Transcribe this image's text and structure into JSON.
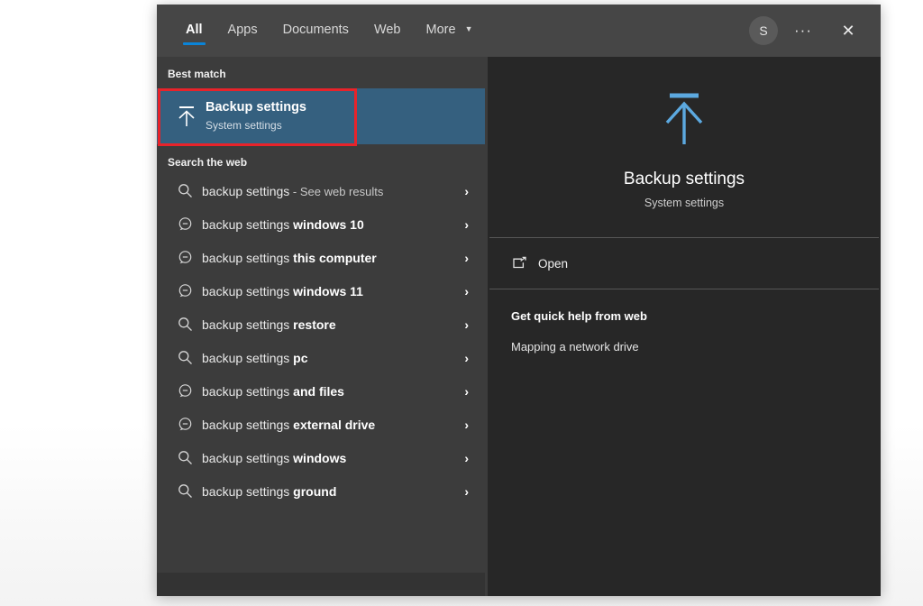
{
  "header": {
    "tabs": [
      {
        "label": "All",
        "active": true,
        "icon": ""
      },
      {
        "label": "Apps",
        "active": false,
        "icon": ""
      },
      {
        "label": "Documents",
        "active": false,
        "icon": ""
      },
      {
        "label": "Web",
        "active": false,
        "icon": ""
      },
      {
        "label": "More",
        "active": false,
        "icon": "chevron-down-icon",
        "caret": "▼"
      }
    ],
    "avatar_initial": "S",
    "more_options_label": "···",
    "close_label": "✕"
  },
  "left_pane": {
    "best_match_heading": "Best match",
    "best_match": {
      "icon": "backup-arrow-icon",
      "title": "Backup settings",
      "subtitle": "System settings"
    },
    "web_heading": "Search the web",
    "results": [
      {
        "icon": "search-icon",
        "query": "backup settings",
        "suffix_muted": " - See web results",
        "bold": "",
        "chevron": "›"
      },
      {
        "icon": "suggestion-bubble-icon",
        "query": "backup settings ",
        "bold": "windows 10",
        "suffix_muted": "",
        "chevron": "›"
      },
      {
        "icon": "suggestion-bubble-icon",
        "query": "backup settings ",
        "bold": "this computer",
        "suffix_muted": "",
        "chevron": "›"
      },
      {
        "icon": "suggestion-bubble-icon",
        "query": "backup settings ",
        "bold": "windows 11",
        "suffix_muted": "",
        "chevron": "›"
      },
      {
        "icon": "search-icon",
        "query": "backup settings ",
        "bold": "restore",
        "suffix_muted": "",
        "chevron": "›"
      },
      {
        "icon": "search-icon",
        "query": "backup settings ",
        "bold": "pc",
        "suffix_muted": "",
        "chevron": "›"
      },
      {
        "icon": "suggestion-bubble-icon",
        "query": "backup settings ",
        "bold": "and files",
        "suffix_muted": "",
        "chevron": "›"
      },
      {
        "icon": "suggestion-bubble-icon",
        "query": "backup settings ",
        "bold": "external drive",
        "suffix_muted": "",
        "chevron": "›"
      },
      {
        "icon": "search-icon",
        "query": "backup settings ",
        "bold": "windows",
        "suffix_muted": "",
        "chevron": "›"
      },
      {
        "icon": "search-icon",
        "query": "backup settings ",
        "bold": "ground",
        "suffix_muted": "",
        "chevron": "›"
      }
    ]
  },
  "preview": {
    "icon": "backup-arrow-icon",
    "title": "Backup settings",
    "subtitle": "System settings",
    "open_label": "Open",
    "open_icon": "open-external-icon",
    "quick_help_title": "Get quick help from web",
    "quick_help_links": [
      "Mapping a network drive"
    ]
  },
  "colors": {
    "accent_blue": "#0a84d8",
    "highlight_blue": "#35607f",
    "hero_icon_blue": "#5ca9e0",
    "annotation_red": "#e8232a",
    "header_gray": "#464646",
    "left_pane_gray": "#3c3c3c",
    "right_pane_gray": "#272727"
  }
}
